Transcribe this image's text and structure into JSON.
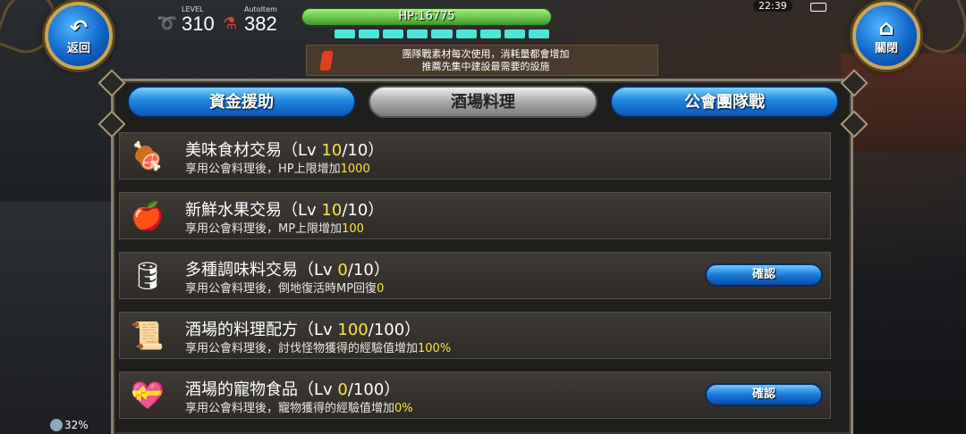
{
  "header": {
    "back_label": "返回",
    "close_label": "關閉",
    "level_caption": "LEVEL",
    "level_value": "310",
    "autoitem_caption": "AutoItem",
    "autoitem_value": "382",
    "hp_text": "HP:16775",
    "clock": "22:39"
  },
  "notice": {
    "line1": "團隊戰素材每次使用，消耗量都會增加",
    "line2": "推薦先集中建設最需要的設施"
  },
  "tabs": [
    {
      "label": "資金援助",
      "active": false
    },
    {
      "label": "酒場料理",
      "active": true
    },
    {
      "label": "公會團隊戰",
      "active": false
    }
  ],
  "items": [
    {
      "title": "美味食材交易（Lv ",
      "lv": "10",
      "max": "/10）",
      "desc": "享用公會料理後，HP上限增加",
      "value": "1000",
      "icon": "meat-icon",
      "glyph": "🍖",
      "confirm": null
    },
    {
      "title": "新鮮水果交易（Lv ",
      "lv": "10",
      "max": "/10）",
      "desc": "享用公會料理後，MP上限增加",
      "value": "100",
      "icon": "apple-icon",
      "glyph": "🍎",
      "confirm": null
    },
    {
      "title": "多種調味料交易（Lv ",
      "lv": "0",
      "max": "/10）",
      "desc": "享用公會料理後，倒地復活時MP回復",
      "value": "0",
      "icon": "barrel-icon",
      "glyph": "🛢",
      "confirm": "確認"
    },
    {
      "title": "酒場的料理配方（Lv ",
      "lv": "100",
      "max": "/100）",
      "desc": "享用公會料理後，討伐怪物獲得的經驗值增加",
      "value": "100%",
      "icon": "scroll-icon",
      "glyph": "📜",
      "confirm": null
    },
    {
      "title": "酒場的寵物食品（Lv ",
      "lv": "0",
      "max": "/100）",
      "desc": "享用公會料理後，寵物獲得的經驗值增加",
      "value": "0%",
      "icon": "pet-food-icon",
      "glyph": "💝",
      "confirm": "確認"
    }
  ],
  "footer": {
    "percent": "32%"
  },
  "colors": {
    "highlight": "#ffe24a",
    "tab_blue": "#1f86e0",
    "hp_green": "#3f9a2a"
  }
}
